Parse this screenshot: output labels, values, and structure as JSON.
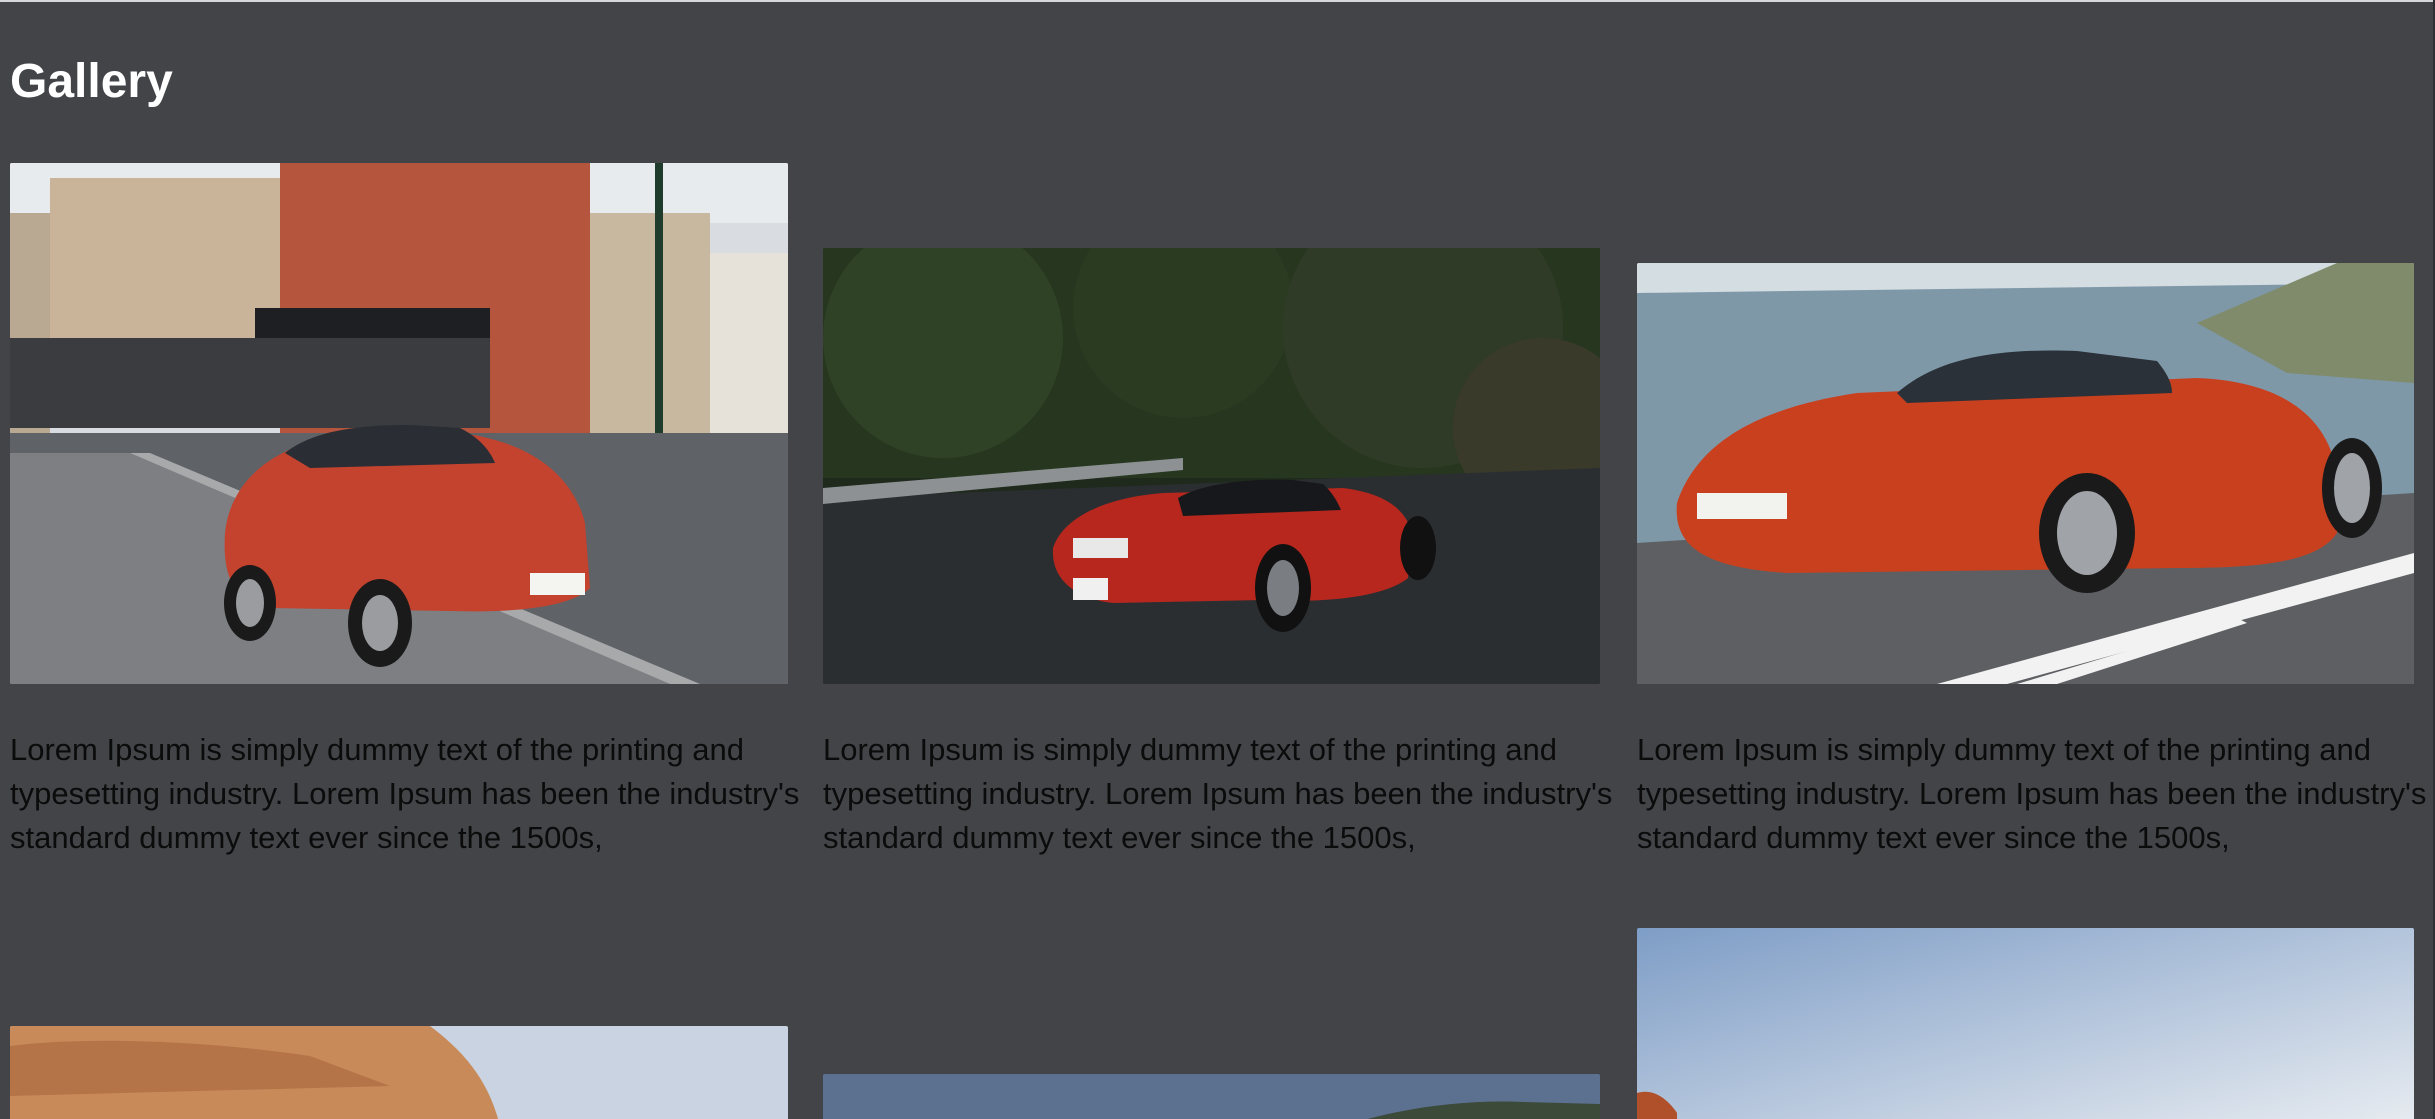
{
  "page": {
    "title": "Gallery"
  },
  "gallery": {
    "items": [
      {
        "image": "red-audi-tt-on-city-street-photo",
        "caption": "Lorem Ipsum is simply dummy text of the printing and typesetting industry. Lorem Ipsum has been the industry's standard dummy text ever since the 1500s,"
      },
      {
        "image": "red-bmw-coupe-on-forest-road-photo",
        "caption": "Lorem Ipsum is simply dummy text of the printing and typesetting industry. Lorem Ipsum has been the industry's standard dummy text ever since the 1500s,"
      },
      {
        "image": "red-porsche-convertible-coastal-road-photo",
        "caption": "Lorem Ipsum is simply dummy text of the printing and typesetting industry. Lorem Ipsum has been the industry's standard dummy text ever since the 1500s,"
      },
      {
        "image": "desert-rock-landscape-photo"
      },
      {
        "image": "mountain-ridge-landscape-photo"
      },
      {
        "image": "sky-landscape-photo"
      }
    ]
  },
  "colors": {
    "background": "#434448",
    "title": "#ffffff",
    "caption_text": "#0b0b0c"
  }
}
